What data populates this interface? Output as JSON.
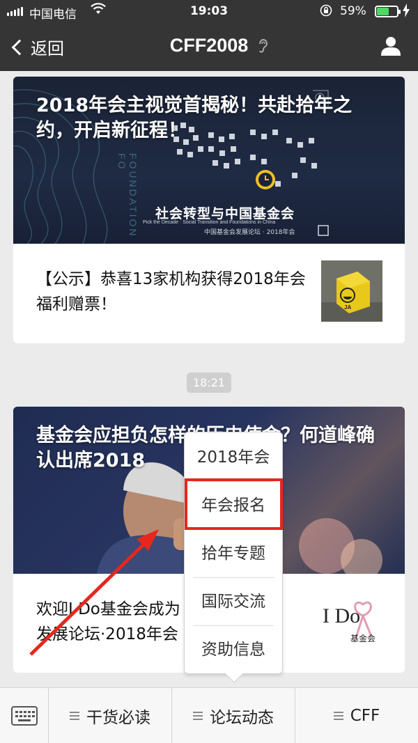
{
  "status_bar": {
    "carrier": "中国电信",
    "time": "19:03",
    "battery_percent": "59%",
    "battery_level": 0.59,
    "icons": [
      "signal-icon",
      "wifi-icon",
      "orientation-lock-icon",
      "battery-icon",
      "charging-icon"
    ]
  },
  "nav": {
    "back_label": "返回",
    "title": "CFF2008",
    "icons": [
      "ear-icon",
      "user-icon"
    ]
  },
  "messages": [
    {
      "headline": "2018年会主视觉首揭秘！共赴拾年之约，开启新征程！",
      "hero_texts": [
        "FOUNDATION FO",
        "社会转型与中国基金会",
        "Pick the Decade · Social Transition and Foundations in China",
        "中国基金会发展论坛 · 2018年会"
      ],
      "sub_text": "【公示】恭喜13家机构获得2018年会福利赠票！",
      "thumb_text": "JA"
    },
    {
      "headline": "基金会应担负怎样的历史使命？何道峰确认出席2018",
      "sub_text": "欢迎I Do基金会成为\n发展论坛·2018年会",
      "thumb_text": "I Do",
      "thumb_subtext": "基金会"
    }
  ],
  "timestamp": "18:21",
  "popup_menu": {
    "items": [
      "2018年会",
      "年会报名",
      "拾年专题",
      "国际交流",
      "资助信息"
    ],
    "highlighted_item": "年会报名"
  },
  "bottom_menu": {
    "tabs": [
      "干货必读",
      "论坛动态",
      "CFF"
    ],
    "icons": [
      "keyboard-icon",
      "menu-icon"
    ]
  },
  "colors": {
    "nav_bg": "#353535",
    "page_bg": "#ebebeb",
    "highlight": "#e5271d",
    "battery": "#4cd964"
  }
}
